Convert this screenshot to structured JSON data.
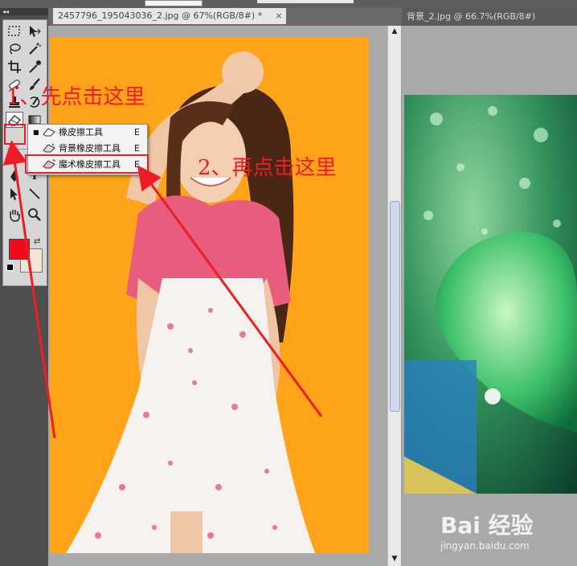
{
  "document1": {
    "tab_title": "2457796_195043036_2.jpg @ 67%(RGB/8#) *",
    "close_glyph": "×",
    "background_color": "#ffa41a"
  },
  "document2": {
    "tab_title": "背景_2.jpg @ 66.7%(RGB/8#)"
  },
  "toolbox": {
    "grip_glyph": "◂◂",
    "foreground_color": "#ee0b1e",
    "background_color": "#f1e6d4",
    "tools": [
      "rectangular-marquee-icon",
      "move-icon",
      "lasso-icon",
      "magic-wand-icon",
      "crop-icon",
      "eyedropper-icon",
      "healing-brush-icon",
      "brush-icon",
      "clone-stamp-icon",
      "history-brush-icon",
      "eraser-icon",
      "gradient-icon",
      "pen-icon",
      "text-icon",
      "path-select-icon",
      "line-icon",
      "hand-icon",
      "zoom-icon"
    ],
    "text_tool_glyph": "T"
  },
  "flyout": {
    "items": [
      {
        "label": "橡皮擦工具",
        "shortcut": "E",
        "selected": true
      },
      {
        "label": "背景橡皮擦工具",
        "shortcut": "E",
        "selected": false
      },
      {
        "label": "魔术橡皮擦工具",
        "shortcut": "E",
        "selected": false
      }
    ],
    "bullet": "■"
  },
  "annotations": {
    "step1": "1、先点击这里",
    "step2": "2、再点击这里",
    "color": "#ee1c25"
  },
  "watermark": {
    "brand": "Bai 经验",
    "url": "jingyan.baidu.com"
  }
}
